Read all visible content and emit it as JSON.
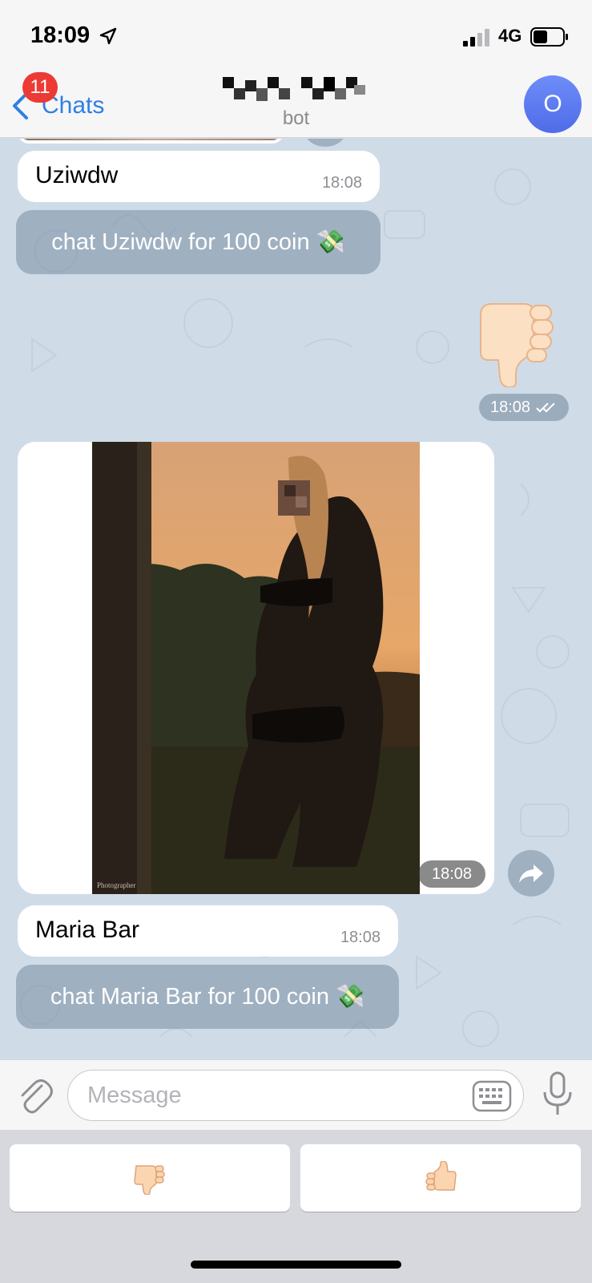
{
  "status_bar": {
    "time": "18:09",
    "network": "4G"
  },
  "nav": {
    "back_label": "Chats",
    "unread_count": "11",
    "subtitle": "bot",
    "avatar_letter": "O"
  },
  "messages": [
    {
      "type": "text",
      "text": "Uziwdw",
      "time": "18:08"
    },
    {
      "type": "inline_button",
      "label": "chat Uziwdw for 100 coin 💸"
    },
    {
      "type": "sticker",
      "icon": "thumbs-down-sticker",
      "time": "18:08",
      "status": "read"
    },
    {
      "type": "photo",
      "time": "18:08",
      "watermark": "Photographer"
    },
    {
      "type": "text",
      "text": "Maria Bar",
      "time": "18:08"
    },
    {
      "type": "inline_button",
      "label": "chat Maria Bar for 100 coin 💸"
    }
  ],
  "input": {
    "placeholder": "Message"
  },
  "reply_keyboard": [
    {
      "icon": "thumbs-down-icon"
    },
    {
      "icon": "thumbs-up-icon"
    }
  ],
  "colors": {
    "accent": "#2f7fe3",
    "badge": "#ec3b34",
    "avatar": "#5b78f0",
    "chat_bg": "#cfdce8"
  }
}
